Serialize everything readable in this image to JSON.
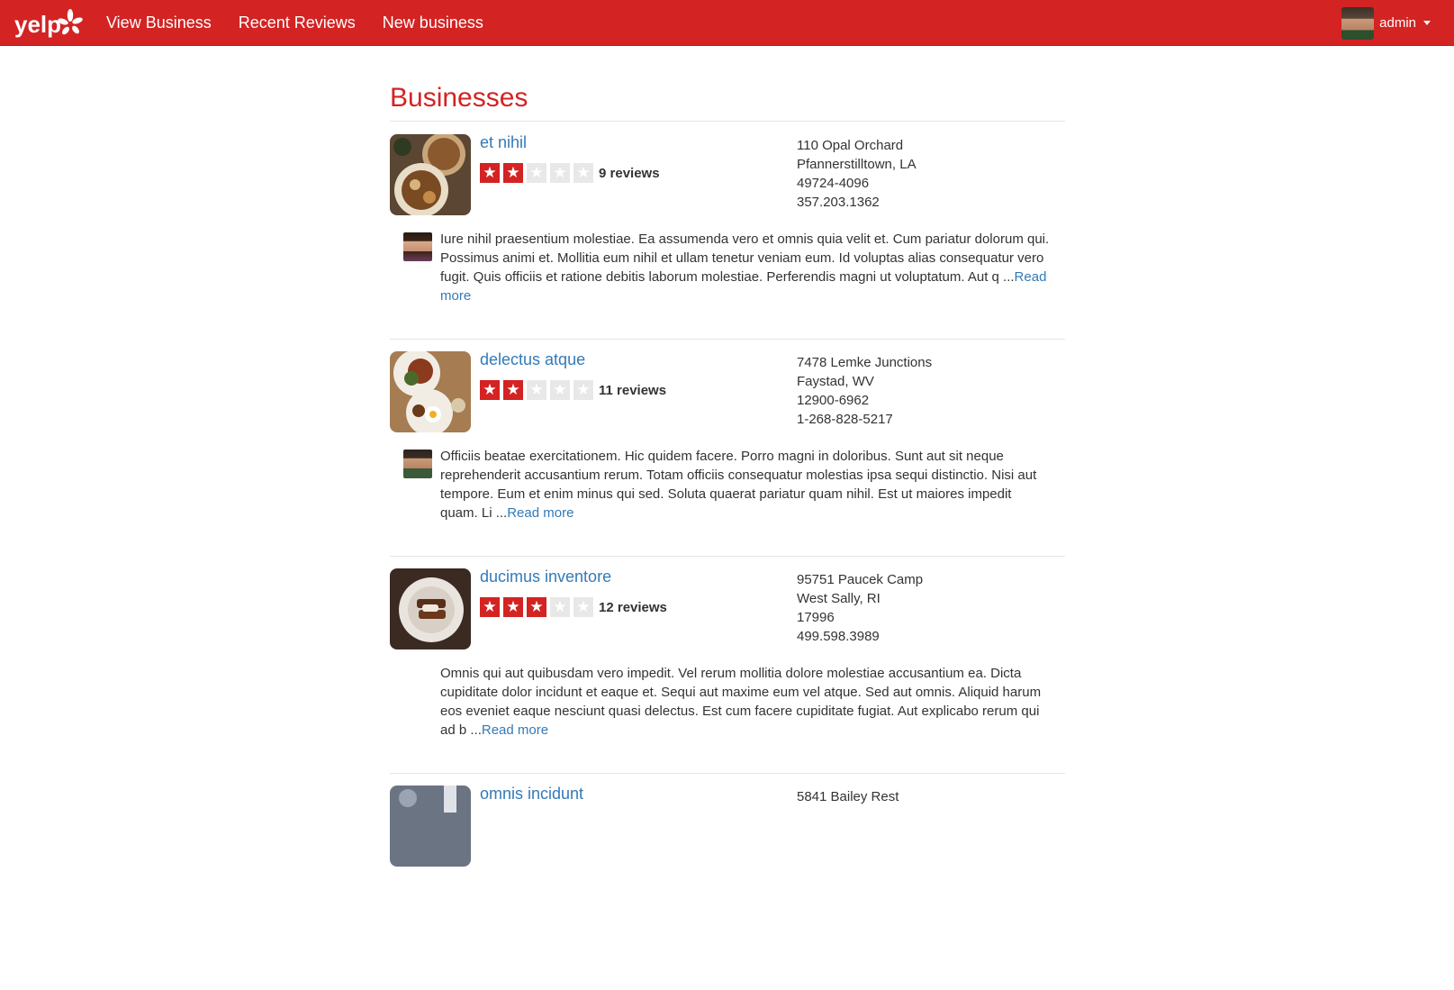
{
  "nav": {
    "logo_text": "yelp",
    "links": [
      "View Business",
      "Recent Reviews",
      "New business"
    ],
    "user_name": "admin"
  },
  "page_title": "Businesses",
  "colors": {
    "brand": "#d32323",
    "link": "#337ab7",
    "star_off": "#e8e8e8"
  },
  "businesses": [
    {
      "name": "et nihil",
      "rating": 2,
      "review_count": "9 reviews",
      "address": [
        "110 Opal Orchard",
        "Pfannerstilltown, LA",
        "49724-4096",
        "357.203.1362"
      ],
      "review_text": "Iure nihil praesentium molestiae. Ea assumenda vero et omnis quia velit et. Cum pariatur dolorum qui. Possimus animi et. Mollitia eum nihil et ullam tenetur veniam eum. Id voluptas alias consequatur vero fugit. Quis officiis et ratione debitis laborum molestiae. Perferendis magni ut voluptatum. Aut q ...",
      "read_more": "Read more",
      "has_reviewer_avatar": true
    },
    {
      "name": "delectus atque",
      "rating": 2,
      "review_count": "11 reviews",
      "address": [
        "7478 Lemke Junctions",
        "Faystad, WV",
        "12900-6962",
        "1-268-828-5217"
      ],
      "review_text": "Officiis beatae exercitationem. Hic quidem facere. Porro magni in doloribus. Sunt aut sit neque reprehenderit accusantium rerum. Totam officiis consequatur molestias ipsa sequi distinctio. Nisi aut tempore. Eum et enim minus qui sed. Soluta quaerat pariatur quam nihil. Est ut maiores impedit quam. Li ...",
      "read_more": "Read more",
      "has_reviewer_avatar": true
    },
    {
      "name": "ducimus inventore",
      "rating": 3,
      "review_count": "12 reviews",
      "address": [
        "95751 Paucek Camp",
        "West Sally, RI",
        "17996",
        "499.598.3989"
      ],
      "review_text": "Omnis qui aut quibusdam vero impedit. Vel rerum mollitia dolore molestiae accusantium ea. Dicta cupiditate dolor incidunt et eaque et. Sequi aut maxime eum vel atque. Sed aut omnis. Aliquid harum eos eveniet eaque nesciunt quasi delectus. Est cum facere cupiditate fugiat. Aut explicabo rerum qui ad b ...",
      "read_more": "Read more",
      "has_reviewer_avatar": false
    },
    {
      "name": "omnis incidunt",
      "address": [
        "5841 Bailey Rest"
      ]
    }
  ]
}
